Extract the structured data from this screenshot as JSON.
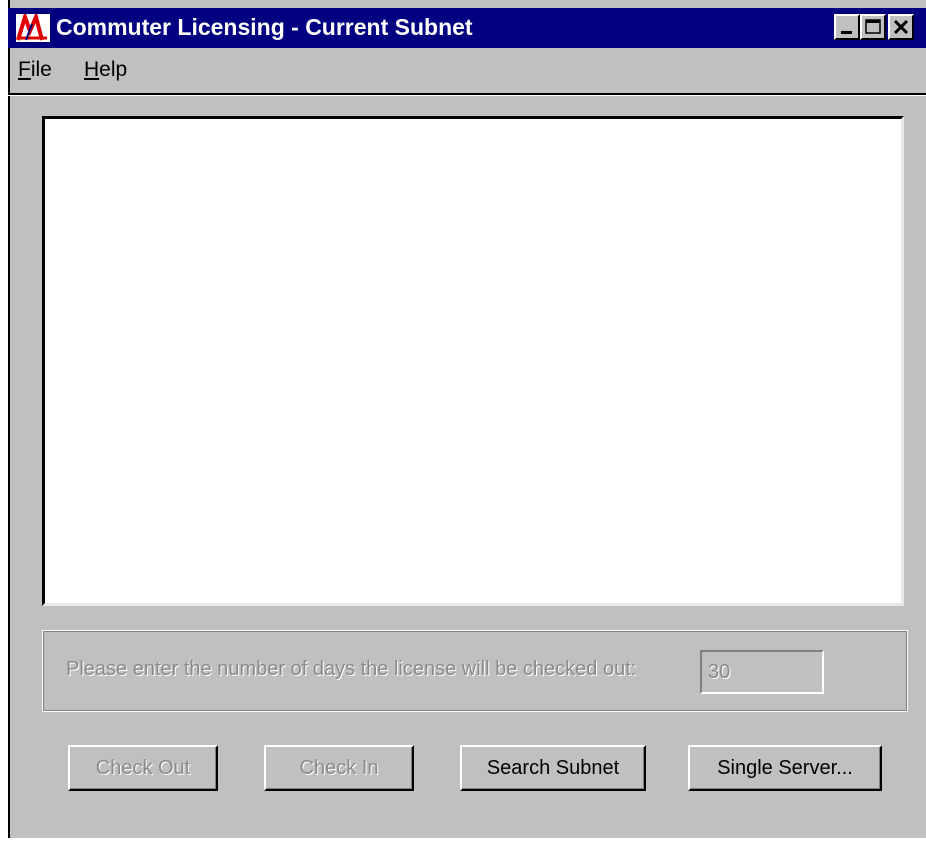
{
  "window": {
    "title": "Commuter Licensing - Current Subnet",
    "icon": "app-logo-icon"
  },
  "caption_buttons": {
    "minimize": "minimize-icon",
    "maximize": "maximize-icon",
    "close": "close-icon"
  },
  "menu": {
    "file": {
      "mnemonic": "F",
      "rest": "ile"
    },
    "help": {
      "mnemonic": "H",
      "rest": "elp"
    }
  },
  "checkout_group": {
    "days_label": "Please enter the number of days the license will be checked out:",
    "days_value": "30",
    "disabled": true
  },
  "buttons": {
    "check_out": {
      "label": "Check Out",
      "disabled": true
    },
    "check_in": {
      "label": "Check In",
      "disabled": true
    },
    "search_subnet": {
      "label": "Search Subnet",
      "disabled": false
    },
    "single_server": {
      "label": "Single Server...",
      "disabled": false
    }
  },
  "colors": {
    "titlebar": "#000080",
    "face": "#c0c0c0",
    "disabled_text": "#8a8a8a"
  }
}
